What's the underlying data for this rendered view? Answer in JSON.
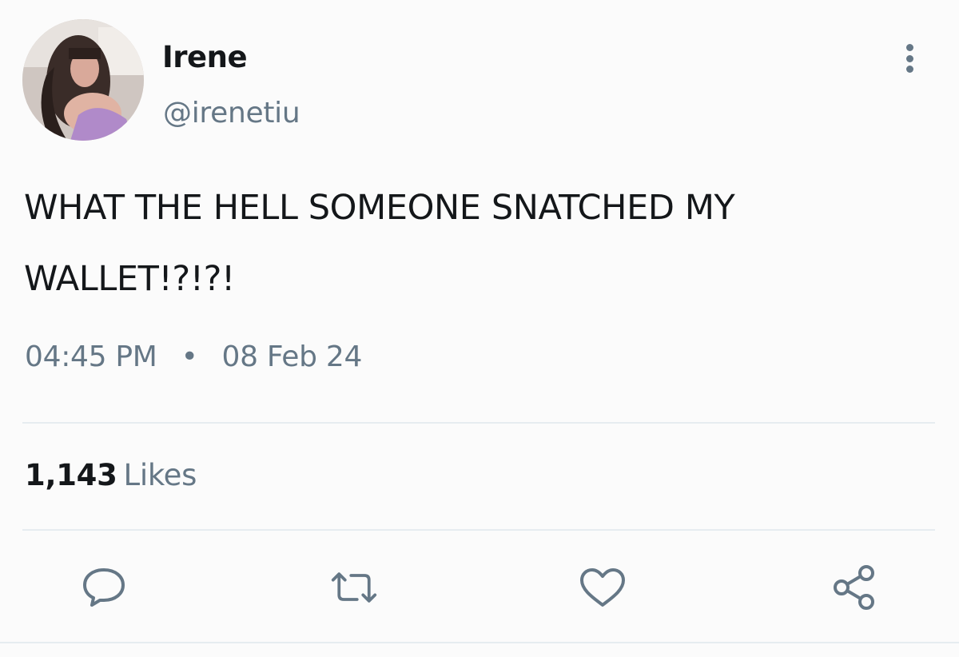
{
  "user": {
    "display_name": "Irene",
    "handle": "@irenetiu"
  },
  "tweet": {
    "text": "WHAT THE HELL SOMEONE SNATCHED MY\nWALLET!?!?!",
    "time": "04:45 PM",
    "separator": "•",
    "date": "08 Feb 24"
  },
  "stats": {
    "likes_count": "1,143",
    "likes_label": "Likes"
  },
  "actions": {
    "icons": [
      "reply-icon",
      "retweet-icon",
      "like-icon",
      "share-icon"
    ]
  },
  "colors": {
    "text_primary": "#14171a",
    "text_secondary": "#657786",
    "divider": "#e6ecf0",
    "background": "#fbfbfb"
  }
}
